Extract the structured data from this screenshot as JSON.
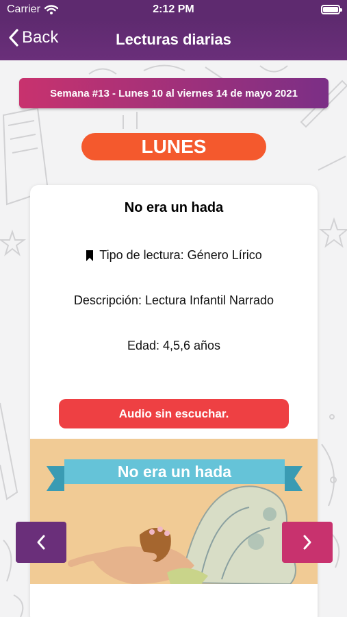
{
  "status_bar": {
    "carrier": "Carrier",
    "time": "2:12 PM",
    "battery_level": 1.0
  },
  "nav": {
    "back_label": "Back",
    "title": "Lecturas diarias"
  },
  "week_banner": "Semana #13 - Lunes 10 al viernes 14 de mayo 2021",
  "day_label": "LUNES",
  "reading": {
    "title": "No era un hada",
    "type": "Tipo de lectura: Género Lírico",
    "description": "Descripción: Lectura Infantil Narrado",
    "age": "Edad: 4,5,6 años",
    "audio_button": "Audio sin escuchar.",
    "image_title": "No era un hada"
  },
  "colors": {
    "purple": "#6a2f7a",
    "magenta": "#c8326e",
    "orange": "#f4592d",
    "red": "#ee4043"
  }
}
